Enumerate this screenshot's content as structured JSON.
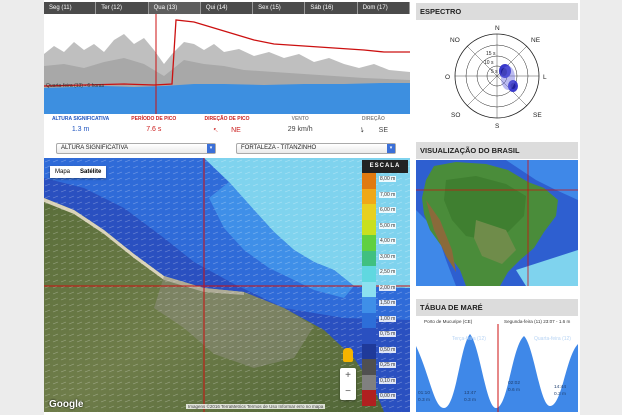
{
  "day_tabs": [
    "Seg (11)",
    "Ter (12)",
    "Qua (13)",
    "Qui (14)",
    "Sex (15)",
    "Sáb (16)",
    "Dom (17)"
  ],
  "active_day_index": 2,
  "chart": {
    "cursor_label": "Quarta-feira (13) - 6 horas"
  },
  "params": [
    {
      "label": "ALTURA SIGNIFICATIVA",
      "value": "1.3 m",
      "label_color": "blue"
    },
    {
      "label": "PERÍODO DE PICO",
      "value": "7.6 s",
      "label_color": "red"
    },
    {
      "label": "DIREÇÃO DE PICO",
      "value": "NE",
      "label_color": "red",
      "icon": "direction-arrow-icon"
    },
    {
      "label": "VENTO",
      "value": "29 km/h",
      "label_color": "gray"
    },
    {
      "label": "DIREÇÃO",
      "value": "SE",
      "label_color": "gray",
      "icon": "wind-arrow-icon"
    }
  ],
  "selectors": {
    "parameter": "ALTURA SIGNIFICATIVA",
    "location": "FORTALEZA - TITANZINHO"
  },
  "map": {
    "toggle_map": "Mapa",
    "toggle_satellite": "Satélite",
    "google_logo": "Google",
    "attribution": "Imagens ©2016 TerraMetrics   Termos de Uso   Informar erro no mapa",
    "zoom_in": "+",
    "zoom_out": "−"
  },
  "scale": {
    "title": "ESCALA",
    "labels": [
      "8,00 m",
      "7,00 m",
      "6,00 m",
      "5,00 m",
      "4,00 m",
      "3,00 m",
      "2,50 m",
      "2,00 m",
      "1,50 m",
      "1,00 m",
      "0,75 m",
      "0,50 m",
      "0,25 m",
      "0,10 m",
      "0,00 m"
    ],
    "colors": [
      "#e07a10",
      "#f0a818",
      "#e8d020",
      "#c8e020",
      "#60d040",
      "#40c080",
      "#60d8e0",
      "#8ce0f0",
      "#3f8fe8",
      "#2d6ed8",
      "#2a50c0",
      "#1f3a9a",
      "#505050",
      "#808080",
      "#b02020"
    ]
  },
  "spectro": {
    "title": "ESPECTRO",
    "directions": {
      "n": "N",
      "ne": "NE",
      "l": "L",
      "se": "SE",
      "s": "S",
      "so": "SO",
      "o": "O",
      "no": "NO"
    },
    "rings": [
      "15 s",
      "10 s",
      "5 s"
    ]
  },
  "brasil": {
    "title": "VISUALIZAÇÃO DO BRASIL"
  },
  "tide": {
    "title": "TÁBUA DE MARÉ",
    "station": "Porto de Mucuripe (CE)",
    "current": "Segunda-feira (11) 23:07 - 1.6 m",
    "day_left": "Terça-feira (12)",
    "day_right": "Quarta-feira (12)",
    "lows": [
      {
        "time": "01:10",
        "height": "0.3 m"
      },
      {
        "time": "13:47",
        "height": "0.3 m"
      },
      {
        "time": "02:02",
        "height": "0.6 m"
      },
      {
        "time": "14:44",
        "height": "0.3 m"
      }
    ]
  }
}
